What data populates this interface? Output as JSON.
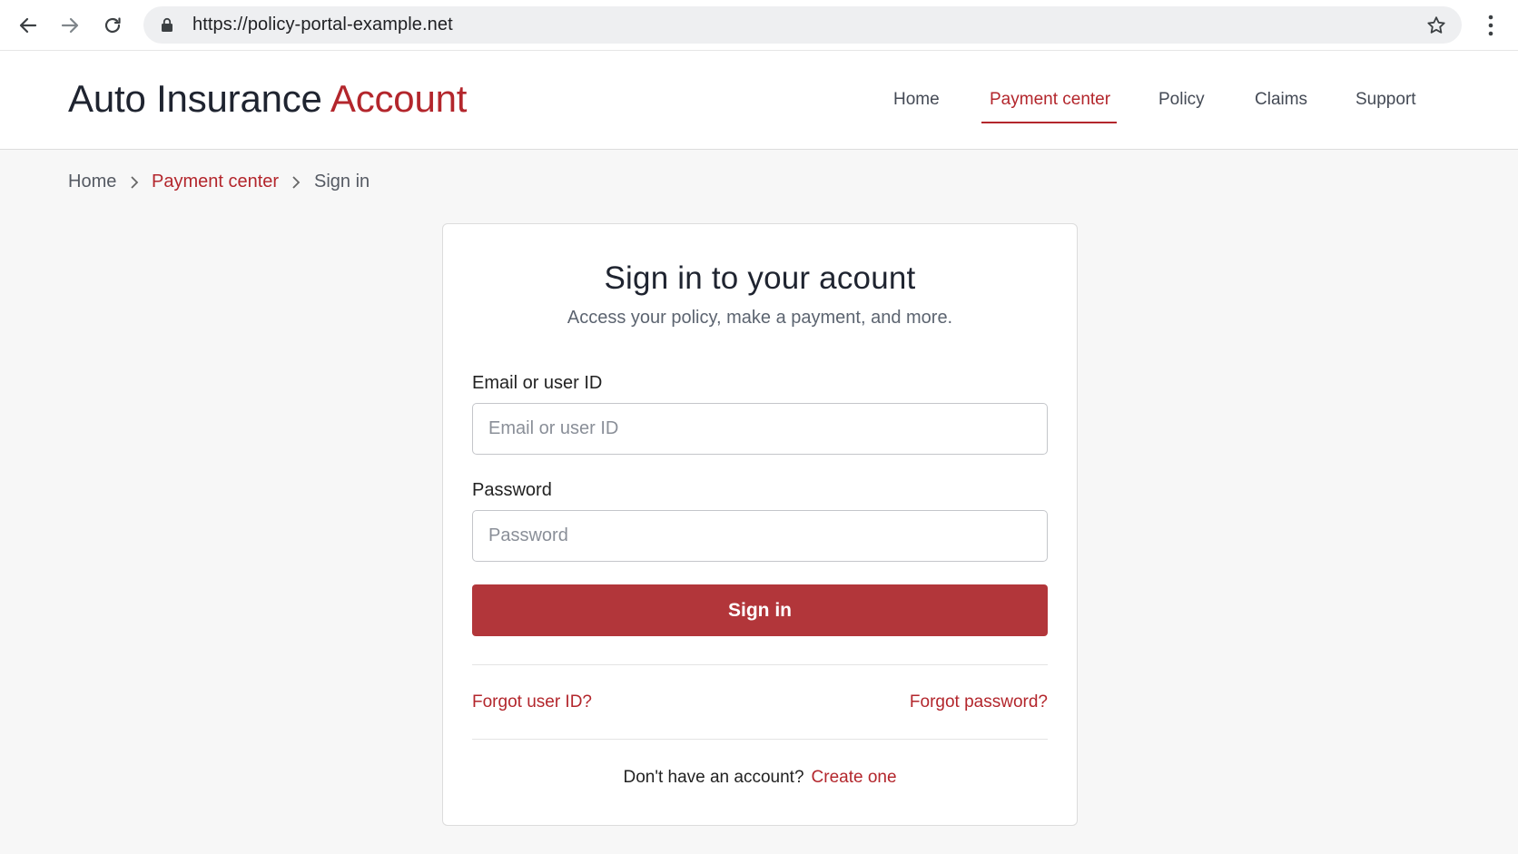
{
  "browser": {
    "url": "https://policy-portal-example.net",
    "icons": [
      "back-arrow-icon",
      "forward-arrow-icon",
      "reload-icon",
      "lock-icon",
      "star-icon",
      "kebab-menu-icon"
    ]
  },
  "header": {
    "brand_main": "Auto Insurance",
    "brand_accent": "Account",
    "nav": [
      {
        "label": "Home",
        "active": false
      },
      {
        "label": "Payment center",
        "active": true
      },
      {
        "label": "Policy",
        "active": false
      },
      {
        "label": "Claims",
        "active": false
      },
      {
        "label": "Support",
        "active": false
      }
    ]
  },
  "breadcrumb": [
    {
      "label": "Home"
    },
    {
      "label": "Payment center"
    },
    {
      "label": "Sign in"
    }
  ],
  "signin": {
    "title": "Sign in to your acount",
    "subtitle": "Access your policy, make a payment, and more.",
    "email_label": "Email or user ID",
    "email_placeholder": "Email or user ID",
    "email_value": "",
    "password_label": "Password",
    "password_placeholder": "Password",
    "password_value": "",
    "submit_label": "Sign in",
    "forgot_user_id": "Forgot user ID?",
    "forgot_password": "Forgot password?",
    "no_account_text": "Don't have an account?",
    "create_account": "Create one"
  },
  "colors": {
    "accent": "#b3262c",
    "button": "#b2363a",
    "page_background": "#f7f7f7"
  }
}
